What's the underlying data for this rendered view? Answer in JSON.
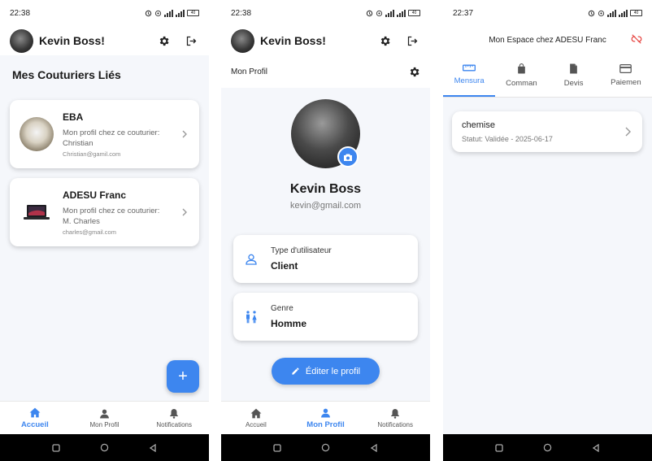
{
  "screen1": {
    "time": "22:38",
    "battery": "40",
    "app_title": "Kevin Boss!",
    "section_title": "Mes Couturiers Liés",
    "tailors": [
      {
        "name": "EBA",
        "line1": "Mon profil chez ce couturier:",
        "line2": "Christian",
        "email": "Christian@gamil.com"
      },
      {
        "name": "ADESU Franc",
        "line1": "Mon profil chez ce couturier:",
        "line2": "M. Charles",
        "email": "charles@gmail.com"
      }
    ],
    "fab_label": "+",
    "nav": {
      "home": "Accueil",
      "profile": "Mon Profil",
      "notifications": "Notifications"
    }
  },
  "screen2": {
    "time": "22:38",
    "battery": "40",
    "app_title": "Kevin Boss!",
    "subtitle": "Mon Profil",
    "name": "Kevin Boss",
    "email": "kevin@gmail.com",
    "user_type_label": "Type d'utilisateur",
    "user_type_value": "Client",
    "gender_label": "Genre",
    "gender_value": "Homme",
    "edit_button": "Éditer le profil",
    "nav": {
      "home": "Accueil",
      "profile": "Mon Profil",
      "notifications": "Notifications"
    }
  },
  "screen3": {
    "time": "22:37",
    "battery": "40",
    "title": "Mon Espace chez ADESU Franc",
    "tabs": [
      "Mensura",
      "Comman",
      "Devis",
      "Paiemen"
    ],
    "item_title": "chemise",
    "item_status": "Statut: Validée - 2025-06-17"
  },
  "colors": {
    "accent": "#3d86ef",
    "unlink": "#e53935"
  }
}
